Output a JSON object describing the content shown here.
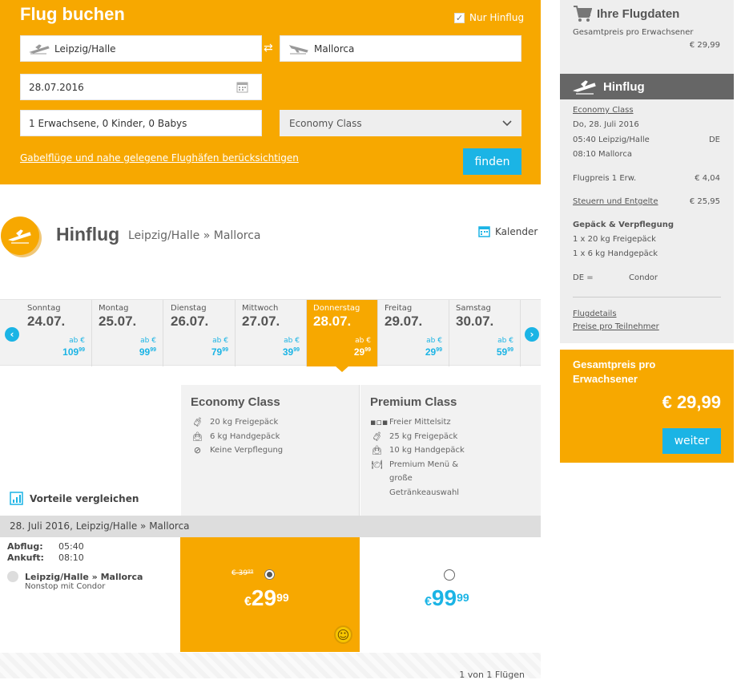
{
  "booking": {
    "title": "Flug buchen",
    "only_outbound": "Nur Hinflug",
    "from": "Leipzig/Halle",
    "to": "Mallorca",
    "date": "28.07.2016",
    "passengers": "1 Erwachsene, 0 Kinder, 0 Babys",
    "cabin": "Economy Class",
    "nearby_link": "Gabelflüge und nahe gelegene Flughäfen berücksichtigen",
    "search_button": "finden"
  },
  "outbound": {
    "heading": "Hinflug",
    "route": "Leipzig/Halle » Mallorca",
    "calendar": "Kalender"
  },
  "days": [
    {
      "weekday": "Sonntag",
      "date": "24.07.",
      "ab": "ab €",
      "price": "109",
      "cents": "99"
    },
    {
      "weekday": "Montag",
      "date": "25.07.",
      "ab": "ab €",
      "price": "99",
      "cents": "99"
    },
    {
      "weekday": "Dienstag",
      "date": "26.07.",
      "ab": "ab €",
      "price": "79",
      "cents": "99"
    },
    {
      "weekday": "Mittwoch",
      "date": "27.07.",
      "ab": "ab €",
      "price": "39",
      "cents": "99"
    },
    {
      "weekday": "Donnerstag",
      "date": "28.07.",
      "ab": "ab €",
      "price": "29",
      "cents": "99"
    },
    {
      "weekday": "Freitag",
      "date": "29.07.",
      "ab": "ab €",
      "price": "29",
      "cents": "99"
    },
    {
      "weekday": "Samstag",
      "date": "30.07.",
      "ab": "ab €",
      "price": "59",
      "cents": "99"
    }
  ],
  "classes": {
    "economy": {
      "name": "Economy Class",
      "features": [
        "20 kg Freigepäck",
        "6 kg Handgepäck",
        "Keine Verpflegung"
      ]
    },
    "premium": {
      "name": "Premium Class",
      "features": [
        "Freier Mittelsitz",
        "25 kg Freigepäck",
        "10 kg Handgepäck",
        "Premium Menü & große Getränkeauswahl"
      ]
    },
    "compare": "Vorteile vergleichen"
  },
  "flight": {
    "route_bar": "28. Juli 2016, Leipzig/Halle » Mallorca",
    "dep_label": "Abflug:",
    "dep_time": "05:40",
    "arr_label": "Ankuft:",
    "arr_time": "08:10",
    "route": "Leipzig/Halle » Mallorca",
    "carrier": "Nonstop mit Condor",
    "eco_old": "€ 39⁹⁹",
    "eco_price": "29",
    "eco_cents": "99",
    "prem_price": "99",
    "prem_cents": "99",
    "currency": "€",
    "count": "1 von 1 Flügen"
  },
  "sidebar": {
    "title": "Ihre Flugdaten",
    "total_label": "Gesamtpreis pro Erwachsener",
    "total": "€ 29,99",
    "leg_title": "Hinflug",
    "cabin": "Economy Class",
    "date": "Do, 28. Juli 2016",
    "dep": "05:40 Leipzig/Halle",
    "dep_code": "DE",
    "arr": "08:10 Mallorca",
    "fare_label": "Flugpreis 1 Erw.",
    "fare": "€ 4,04",
    "tax_label": "Steuern und Entgelte",
    "tax": "€ 25,95",
    "baggage_title": "Gepäck & Verpflegung",
    "bag1": "1 x 20 kg Freigepäck",
    "bag2": "1 x 6 kg Handgepäck",
    "carrier_code": "DE =",
    "carrier": "Condor",
    "details_link": "Flugdetails",
    "prices_link": "Preise pro Teilnehmer",
    "grand_label": "Gesamtpreis pro Erwachsener",
    "grand_total": "€ 29,99",
    "next_button": "weiter"
  },
  "colors": {
    "accent": "#f7a800",
    "blue": "#1bb4e5",
    "dark": "#666666"
  }
}
